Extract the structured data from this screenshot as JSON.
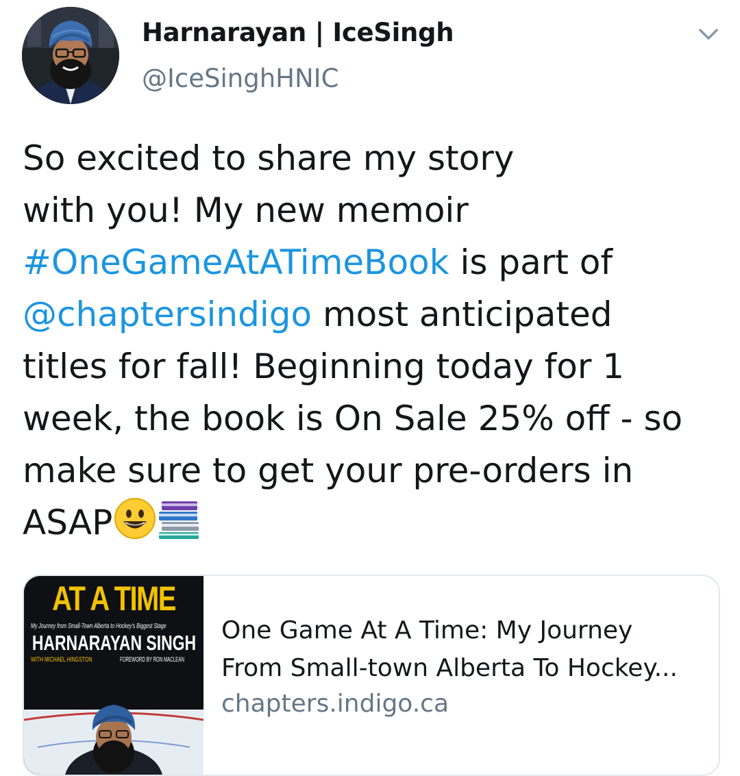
{
  "tweet": {
    "author": {
      "name": "Harnarayan | IceSingh",
      "handle": "@IceSinghHNIC"
    },
    "text_lines": [
      [
        {
          "t": "So excited to share my story"
        }
      ],
      [
        {
          "t": "with you! My new memoir"
        }
      ],
      [
        {
          "t": "#OneGameAtATimeBook",
          "link": true
        },
        {
          "t": " is part of"
        }
      ],
      [
        {
          "t": "@chaptersindigo",
          "link": true
        },
        {
          "t": " most anticipated"
        }
      ],
      [
        {
          "t": "titles for fall! Beginning today for 1"
        }
      ],
      [
        {
          "t": "week, the book is On Sale 25% off - so"
        }
      ],
      [
        {
          "t": "make sure to get your pre-orders in"
        }
      ],
      [
        {
          "t": "ASAP"
        }
      ]
    ],
    "emojis": [
      "grinning-face-emoji",
      "books-emoji"
    ],
    "link_color": "#1b95e0"
  },
  "card": {
    "title_line1": "One Game At A Time: My Journey",
    "title_line2": "From Small-town Alberta To Hockey...",
    "domain": "chapters.indigo.ca",
    "cover": {
      "title_partial": "AT A TIME",
      "subtitle": "My Journey from Small-Town Alberta to Hockey's Biggest Stage",
      "author": "HARNARAYAN SINGH",
      "with_line": "WITH MICHAEL HINGSTON",
      "foreword_line": "FOREWORD BY RON MACLEAN"
    }
  }
}
